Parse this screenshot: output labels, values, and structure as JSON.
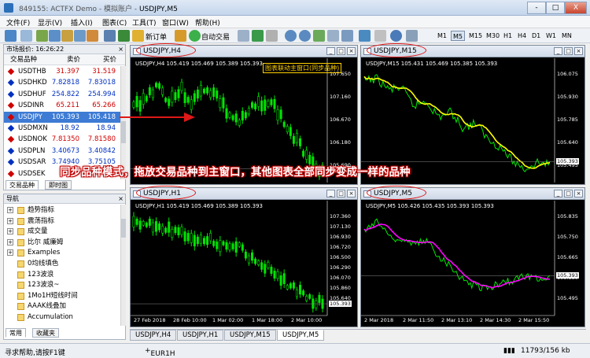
{
  "window": {
    "title_prefix": "849155: ACTFX Demo - 模拟账户 -",
    "title_symbol": "USDJPY,M5",
    "min": "-",
    "max": "□",
    "close": "X"
  },
  "menu": [
    "文件(F)",
    "显示(V)",
    "插入(I)",
    "图表(C)",
    "工具(T)",
    "窗口(W)",
    "帮助(H)"
  ],
  "toolbar": {
    "new_order": "新订单",
    "auto_trade": "自动交易",
    "timeframes": [
      "M1",
      "M5",
      "M15",
      "M30",
      "H1",
      "H4",
      "D1",
      "W1",
      "MN"
    ],
    "active_tf": "M5"
  },
  "market_watch": {
    "title": "市场报价: 16:26:22",
    "col_symbol": "交易品种",
    "col_bid": "卖价",
    "col_ask": "买价",
    "rows": [
      {
        "symbol": "USDTHB",
        "bid": "31.397",
        "ask": "31.519",
        "color": "#d00000"
      },
      {
        "symbol": "USDHKD",
        "bid": "7.82818",
        "ask": "7.83018",
        "color": "#0030c0"
      },
      {
        "symbol": "USDHUF",
        "bid": "254.822",
        "ask": "254.994",
        "color": "#0030c0"
      },
      {
        "symbol": "USDINR",
        "bid": "65.211",
        "ask": "65.266",
        "color": "#d00000"
      },
      {
        "symbol": "USDJPY",
        "bid": "105.393",
        "ask": "105.418",
        "color": "#d00000"
      },
      {
        "symbol": "USDMXN",
        "bid": "18.92",
        "ask": "18.94",
        "color": "#0030c0"
      },
      {
        "symbol": "USDNOK",
        "bid": "7.81350",
        "ask": "7.81580",
        "color": "#d00000"
      },
      {
        "symbol": "USDPLN",
        "bid": "3.40673",
        "ask": "3.40842",
        "color": "#0030c0"
      },
      {
        "symbol": "USDSAR",
        "bid": "3.74940",
        "ask": "3.75105",
        "color": "#0030c0"
      },
      {
        "symbol": "USDSEK",
        "bid": "",
        "ask": "",
        "color": "#d00000"
      }
    ],
    "tab_symbols": "交易品种",
    "tab_ticks": "即时图"
  },
  "navigator": {
    "title": "导航",
    "items": [
      "趋势指标",
      "震荡指标",
      "成交量",
      "比尔 威廉姆",
      "Examples",
      "0均线填色",
      "123波浪",
      "123波浪~",
      "1Mo1H短线时间",
      "AAAK线叠加",
      "Accumulation"
    ],
    "tab_common": "常用",
    "tab_favorites": "收藏夹"
  },
  "annotation": {
    "banner": "同步品种模式，拖放交易品种到主窗口，其他图表全部同步变成一样的品种",
    "link_label": "图表联动主窗口(同步品种)"
  },
  "charts": [
    {
      "name": "USDJPY,H4",
      "info": "USDJPY,H4  105.419 105.469 105.389 105.393",
      "prices": [
        "107.650",
        "107.160",
        "106.670",
        "106.180",
        "105.690"
      ],
      "last": "105.393",
      "dates": []
    },
    {
      "name": "USDJPY,M15",
      "info": "USDJPY,M15  105.431 105.469 105.385 105.393",
      "prices": [
        "106.075",
        "105.930",
        "105.785",
        "105.640",
        "105.495"
      ],
      "last": "105.393",
      "dates": []
    },
    {
      "name": "USDJPY,H1",
      "info": "USDJPY,H1  105.419 105.469 105.389 105.393",
      "prices": [
        "107.360",
        "107.130",
        "106.930",
        "106.720",
        "106.500",
        "106.290",
        "106.070",
        "105.860",
        "105.640"
      ],
      "last": "105.393",
      "dates": [
        "27 Feb 2018",
        "28 Feb 10:00",
        "1 Mar 02:00",
        "1 Mar 18:00",
        "2 Mar 10:00"
      ]
    },
    {
      "name": "USDJPY,M5",
      "info": "USDJPY,M5  105.426 105.435 105.393 105.393",
      "prices": [
        "105.835",
        "105.750",
        "105.665",
        "105.580",
        "105.495"
      ],
      "last": "105.393",
      "dates": [
        "2 Mar 2018",
        "2 Mar 11:50",
        "2 Mar 13:10",
        "2 Mar 14:30",
        "2 Mar 15:50"
      ]
    }
  ],
  "window_tabs": [
    "USDJPY,H4",
    "USDJPY,H1",
    "USDJPY,M15",
    "USDJPY,M5"
  ],
  "active_window_tab": "USDJPY,M5",
  "status": {
    "help": "寻求帮助,请按F1键",
    "profile": "EUR1H",
    "traffic": "11793/156 kb"
  }
}
